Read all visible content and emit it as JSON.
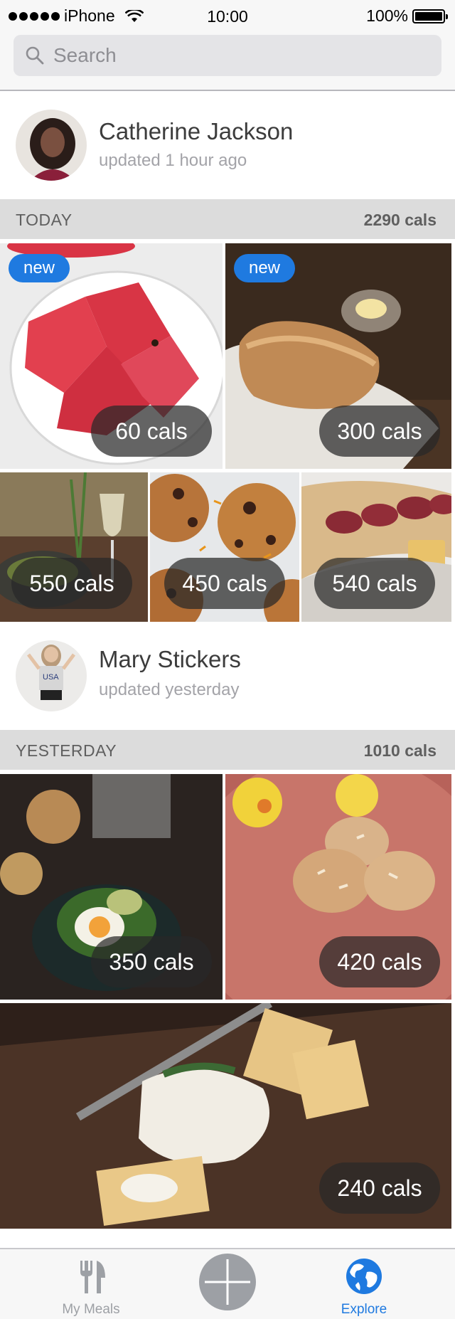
{
  "status_bar": {
    "carrier": "iPhone",
    "time": "10:00",
    "battery": "100%"
  },
  "search": {
    "placeholder": "Search"
  },
  "feed": [
    {
      "user": {
        "name": "Catherine Jackson",
        "updated": "updated 1 hour ago"
      },
      "section": {
        "label": "TODAY",
        "total": "2290 cals"
      },
      "meals": [
        {
          "cals": "60 cals",
          "badge": "new",
          "subject": "watermelon"
        },
        {
          "cals": "300 cals",
          "badge": "new",
          "subject": "bread"
        },
        {
          "cals": "550 cals",
          "subject": "salad-and-wine"
        },
        {
          "cals": "450 cals",
          "subject": "cookies"
        },
        {
          "cals": "540 cals",
          "subject": "salami-sandwich"
        }
      ]
    },
    {
      "user": {
        "name": "Mary Stickers",
        "updated": "updated yesterday"
      },
      "section": {
        "label": "YESTERDAY",
        "total": "1010 cals"
      },
      "meals": [
        {
          "cals": "350 cals",
          "subject": "egg-avocado-toast"
        },
        {
          "cals": "420 cals",
          "subject": "almond-cookies"
        },
        {
          "cals": "240 cals",
          "subject": "crackers-and-cheese"
        }
      ]
    }
  ],
  "tab_bar": {
    "items": [
      {
        "label": "My Meals",
        "icon": "fork-knife-icon",
        "active": false
      },
      {
        "label": "",
        "icon": "plus-icon",
        "active": false
      },
      {
        "label": "Explore",
        "icon": "globe-icon",
        "active": true
      }
    ]
  },
  "colors": {
    "accent": "#1f7ae0",
    "inactive": "#9da0a5",
    "section_bg": "#dcdcdc"
  }
}
